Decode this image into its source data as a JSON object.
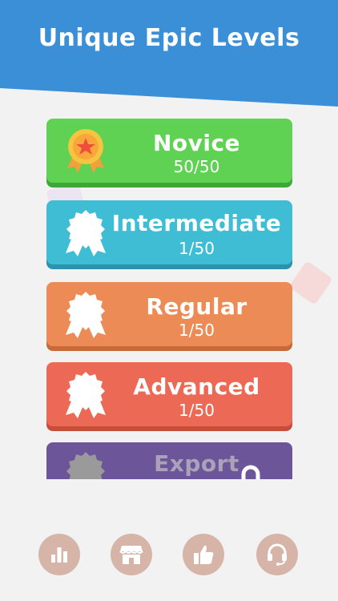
{
  "header": {
    "title": "Unique Epic Levels"
  },
  "levels": [
    {
      "name": "Novice",
      "progress": "50/50",
      "color": "#5fd153",
      "edge": "#3fa63a",
      "status": "completed",
      "badge_icon": "gold-medal-icon"
    },
    {
      "name": "Intermediate",
      "progress": "1/50",
      "color": "#3ebdd5",
      "edge": "#2b94ab",
      "status": "in-progress",
      "badge_icon": "ribbon-badge-icon"
    },
    {
      "name": "Regular",
      "progress": "1/50",
      "color": "#ec8b55",
      "edge": "#c76a37",
      "status": "in-progress",
      "badge_icon": "ribbon-badge-icon"
    },
    {
      "name": "Advanced",
      "progress": "1/50",
      "color": "#ec6a55",
      "edge": "#c64d3a",
      "status": "in-progress",
      "badge_icon": "ribbon-badge-icon"
    },
    {
      "name": "Export",
      "progress": "",
      "color": "#6c5599",
      "edge": "#523f78",
      "status": "locked",
      "badge_icon": "ribbon-badge-icon"
    }
  ],
  "bottom_nav": [
    {
      "icon": "bar-chart-icon"
    },
    {
      "icon": "store-icon"
    },
    {
      "icon": "thumbs-up-icon"
    },
    {
      "icon": "headset-support-icon"
    }
  ],
  "colors": {
    "header": "#3a8fd6",
    "background": "#f2f2f3",
    "nav_button": "#d6b5a8",
    "badge_gold": "#f5c542",
    "badge_locked": "#9a9a9a"
  }
}
